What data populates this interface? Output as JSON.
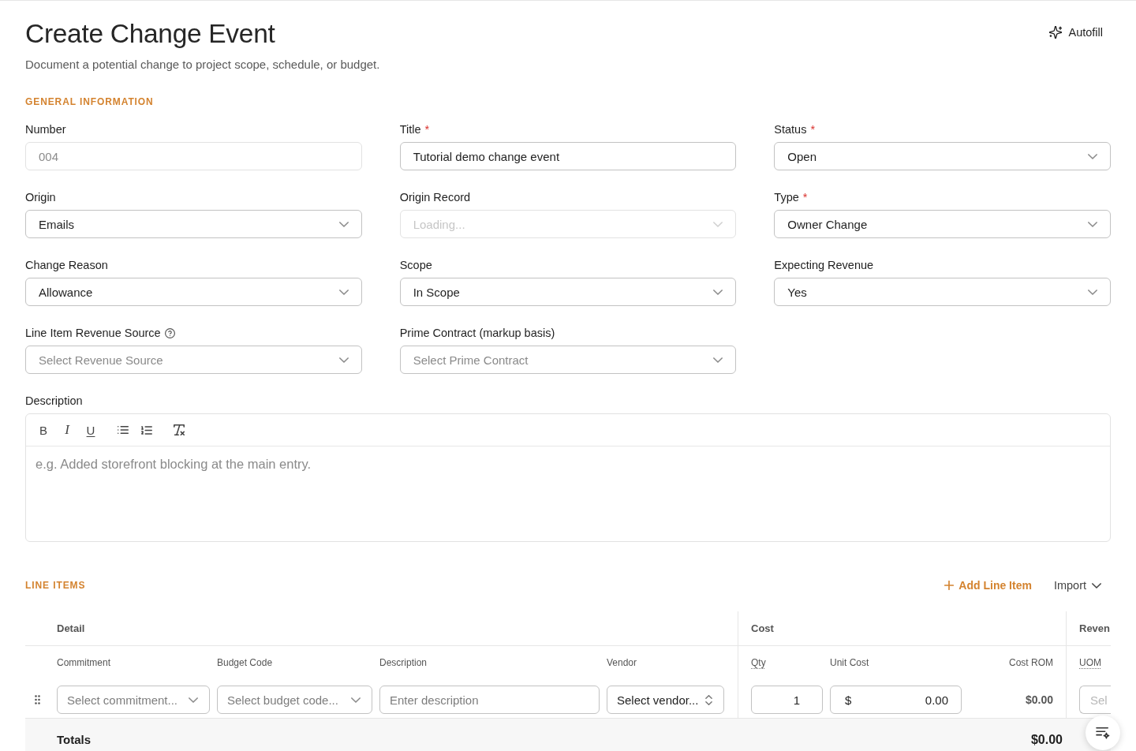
{
  "header": {
    "title": "Create Change Event",
    "subtitle": "Document a potential change to project scope, schedule, or budget.",
    "autofill_button": "Autofill"
  },
  "general_information": {
    "heading": "GENERAL INFORMATION",
    "fields": [
      {
        "kind": "text",
        "label": "Number",
        "help": false,
        "disabled": true,
        "value": "004"
      },
      {
        "kind": "text",
        "label": "Title",
        "required_mark": "*",
        "help": false,
        "disabled": false,
        "value": "Tutorial demo change event"
      },
      {
        "kind": "select",
        "label": "Status",
        "required_mark": "*",
        "help": false,
        "disabled": false,
        "value": "Open"
      },
      {
        "kind": "select",
        "label": "Origin",
        "help": false,
        "disabled": false,
        "value": "Emails"
      },
      {
        "kind": "select",
        "label": "Origin Record",
        "help": false,
        "disabled": true,
        "placeholder": "Loading..."
      },
      {
        "kind": "select",
        "label": "Type",
        "required_mark": "*",
        "help": false,
        "disabled": false,
        "value": "Owner Change"
      },
      {
        "kind": "select",
        "label": "Change Reason",
        "help": false,
        "disabled": false,
        "value": "Allowance"
      },
      {
        "kind": "select",
        "label": "Scope",
        "help": false,
        "disabled": false,
        "value": "In Scope"
      },
      {
        "kind": "select",
        "label": "Expecting Revenue",
        "help": false,
        "disabled": false,
        "value": "Yes"
      },
      {
        "kind": "select",
        "label": "Line Item Revenue Source",
        "help": true,
        "disabled": false,
        "placeholder": "Select Revenue Source"
      },
      {
        "kind": "select",
        "label": "Prime Contract (markup basis)",
        "help": false,
        "disabled": false,
        "placeholder": "Select Prime Contract"
      }
    ],
    "description": {
      "label": "Description",
      "toolbar_groups": [
        {
          "buttons": [
            {
              "kind": "bold",
              "glyph": "B"
            },
            {
              "kind": "italic",
              "glyph": "I"
            },
            {
              "kind": "underline",
              "glyph": "U"
            }
          ]
        },
        {
          "buttons": [
            {
              "kind": "bullet-list"
            },
            {
              "kind": "numbered-list"
            }
          ]
        },
        {
          "buttons": [
            {
              "kind": "clear-formatting"
            }
          ]
        }
      ],
      "placeholder": "e.g. Added storefront blocking at the main entry."
    }
  },
  "line_items": {
    "heading": "LINE ITEMS",
    "add_button": "Add Line Item",
    "import_button": "Import",
    "groups": [
      {
        "label": "Detail",
        "columns": [
          {
            "label": "Commitment",
            "tooltip": false
          },
          {
            "label": "Budget Code",
            "tooltip": false
          },
          {
            "label": "Description",
            "tooltip": false
          },
          {
            "label": "Vendor",
            "tooltip": false
          }
        ]
      },
      {
        "label": "Cost",
        "columns": [
          {
            "label": "Qty",
            "tooltip": true
          },
          {
            "label": "Unit Cost",
            "tooltip": false
          },
          {
            "label": "Cost ROM",
            "tooltip": false
          }
        ]
      },
      {
        "label": "Reven",
        "columns": [
          {
            "label": "UOM",
            "tooltip": true
          }
        ]
      }
    ],
    "rows": [
      {
        "cells": [
          {
            "kind": "select",
            "placeholder": "Select commitment..."
          },
          {
            "kind": "select",
            "placeholder": "Select budget code..."
          },
          {
            "kind": "text",
            "placeholder": "Enter description"
          },
          {
            "kind": "combobox",
            "placeholder": "Select vendor..."
          },
          {
            "kind": "number",
            "value": "1"
          },
          {
            "kind": "currency",
            "prefix": "$",
            "value": "0.00"
          },
          {
            "kind": "amount",
            "value": "$0.00"
          },
          {
            "kind": "partial",
            "placeholder": "Sel"
          }
        ]
      }
    ],
    "totals": {
      "label": "Totals",
      "cost_total": "$0.00"
    }
  }
}
